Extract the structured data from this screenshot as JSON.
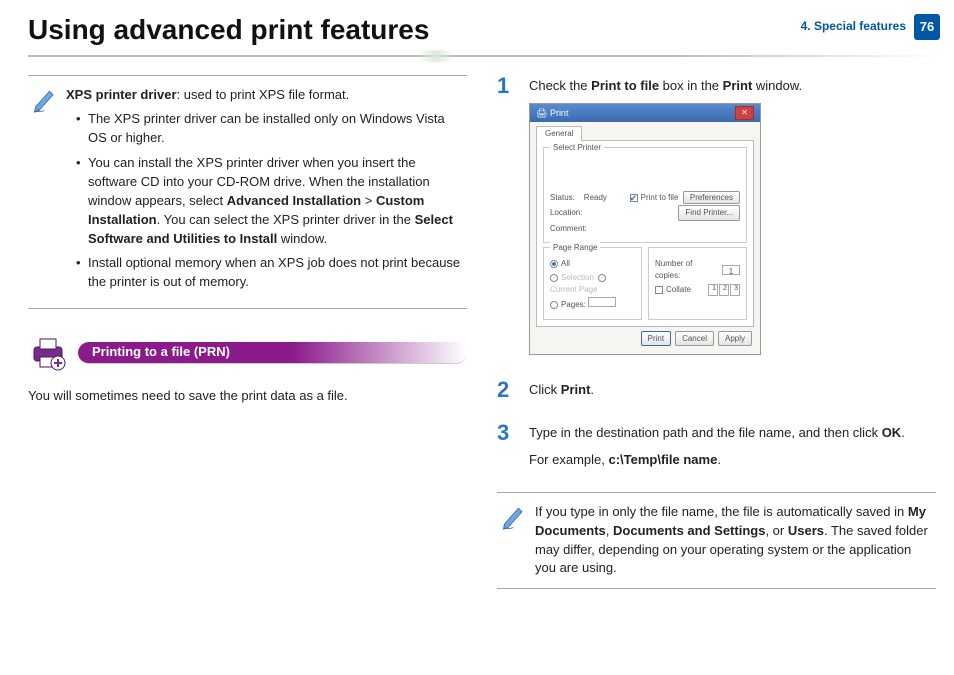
{
  "header": {
    "title": "Using advanced print features",
    "section": "4.  Special features",
    "page_num": "76"
  },
  "left": {
    "note": {
      "lead_bold": "XPS printer driver",
      "lead_rest": ": used to print XPS file format.",
      "b1": "The XPS printer driver can be installed only on Windows Vista OS or higher.",
      "b2a": "You can install the XPS printer driver when you insert the software CD into your CD-ROM drive. When the installation window appears, select ",
      "b2b": "Advanced Installation",
      "b2c": " > ",
      "b2d": "Custom Installation",
      "b2e": ". You can select the XPS printer driver in the ",
      "b2f": "Select Software and Utilities to Install",
      "b2g": " window.",
      "b3": "Install optional memory when an XPS job does not print because the printer is out of memory."
    },
    "section_title": "Printing to a file (PRN)",
    "body": "You will sometimes need to save the print data as a file."
  },
  "right": {
    "s1": {
      "num": "1",
      "a": "Check the ",
      "b": "Print to file",
      "c": " box in the ",
      "d": "Print",
      "e": " window."
    },
    "s2": {
      "num": "2",
      "a": "Click ",
      "b": "Print",
      "c": "."
    },
    "s3": {
      "num": "3",
      "a": "Type in the destination path and the file name, and then click ",
      "b": "OK",
      "c": ".",
      "ex_a": "For example, ",
      "ex_b": "c:\\Temp\\file name",
      "ex_c": "."
    },
    "note2": {
      "a": "If you type in only the file name, the file is automatically saved in ",
      "b": "My Documents",
      "c": ", ",
      "d": "Documents and Settings",
      "e": ", or ",
      "f": "Users",
      "g": ". The saved folder may differ, depending on your operating system or the application you are using."
    },
    "dialog": {
      "title": "Print",
      "tab": "General",
      "select_printer": "Select Printer",
      "status": "Status:",
      "ready": "Ready",
      "location": "Location:",
      "comment": "Comment:",
      "print_to_file": "Print to file",
      "preferences": "Preferences",
      "find_printer": "Find Printer...",
      "page_range": "Page Range",
      "all": "All",
      "selection": "Selection",
      "current_page": "Current Page",
      "pages": "Pages:",
      "copies_label": "Number of copies:",
      "copies_val": "1",
      "collate": "Collate",
      "print_btn": "Print",
      "cancel": "Cancel",
      "apply": "Apply"
    }
  }
}
